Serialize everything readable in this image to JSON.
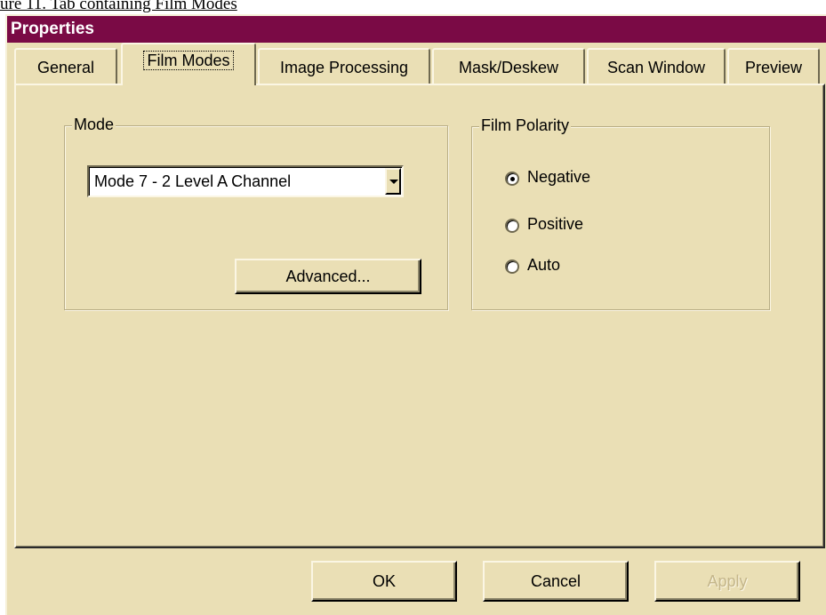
{
  "doc_header": "ure 11. Tab containing Film Modes",
  "window": {
    "title": "Properties"
  },
  "tabs": [
    {
      "label": "General",
      "active": false
    },
    {
      "label": "Film Modes",
      "active": true
    },
    {
      "label": "Image Processing",
      "active": false
    },
    {
      "label": "Mask/Deskew",
      "active": false
    },
    {
      "label": "Scan Window",
      "active": false
    },
    {
      "label": "Preview",
      "active": false
    }
  ],
  "mode_group": {
    "legend": "Mode",
    "selected": "Mode 7 - 2 Level A Channel",
    "advanced_label": "Advanced..."
  },
  "polarity_group": {
    "legend": "Film Polarity",
    "options": [
      {
        "label": "Negative",
        "checked": true
      },
      {
        "label": "Positive",
        "checked": false
      },
      {
        "label": "Auto",
        "checked": false
      }
    ]
  },
  "footer": {
    "ok_label": "OK",
    "cancel_label": "Cancel",
    "apply_label": "Apply"
  },
  "colors": {
    "title_bar": "#7a0a45",
    "dialog_face": "#eadfb5"
  }
}
